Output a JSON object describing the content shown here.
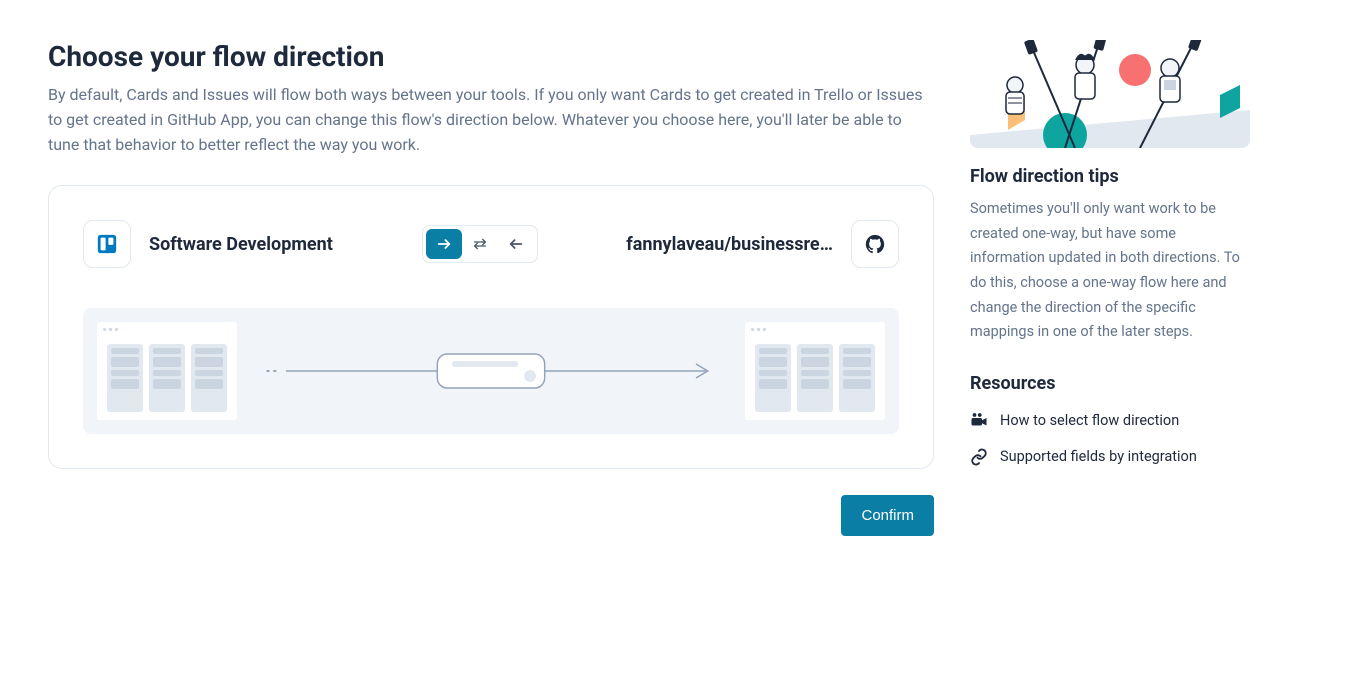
{
  "main": {
    "heading": "Choose your flow direction",
    "description": "By default, Cards and Issues will flow both ways between your tools. If you only want Cards to get created in Trello or Issues to get created in GitHub App, you can change this flow's direction below. Whatever you choose here, you'll later be able to tune that behavior to better reflect the way you work.",
    "source_label": "Software Development",
    "dest_label": "fannylaveau/businessre…",
    "confirm_label": "Confirm",
    "direction_selected": "right"
  },
  "sidebar": {
    "tips_heading": "Flow direction tips",
    "tips_text": "Sometimes you'll only want work to be created one-way, but have some information updated in both directions. To do this, choose a one-way flow here and change the direction of the specific mappings in one of the later steps.",
    "resources_heading": "Resources",
    "resources": [
      {
        "icon": "video",
        "label": "How to select flow direction"
      },
      {
        "icon": "link",
        "label": "Supported fields by integration"
      }
    ]
  }
}
